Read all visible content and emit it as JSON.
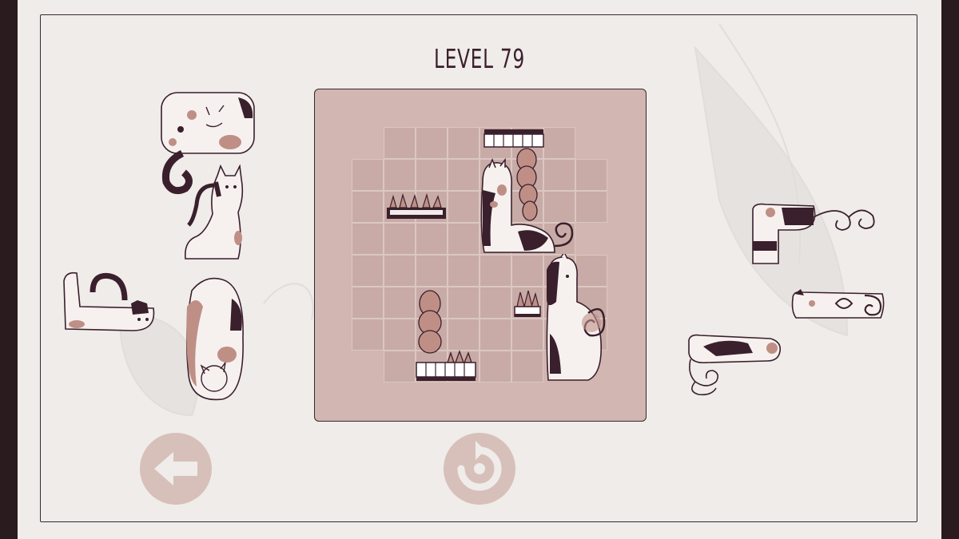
{
  "level": {
    "title": "LEVEL 79"
  },
  "board": {
    "grid_cols": 8,
    "grid_rows": 8,
    "empty_cells": [
      [
        0,
        0
      ],
      [
        7,
        0
      ],
      [
        7,
        3
      ],
      [
        0,
        7
      ],
      [
        6,
        7
      ],
      [
        7,
        7
      ]
    ]
  },
  "tray_left": {
    "pieces": [
      "calico-cat-curled",
      "white-cat-sitting",
      "white-cat-lying",
      "cat-stretched-vertical"
    ]
  },
  "tray_right": {
    "pieces": [
      "cat-curl-tail-horizontal",
      "cat-lying-short",
      "cat-lying-long"
    ]
  },
  "controls": {
    "back_icon": "arrow-left-icon",
    "restart_icon": "restart-icon"
  },
  "colors": {
    "board": "#d1b6b1",
    "cell": "#c8aba6",
    "ink": "#3a1f2c",
    "button": "#d7c0b9",
    "paper": "#efecea"
  }
}
